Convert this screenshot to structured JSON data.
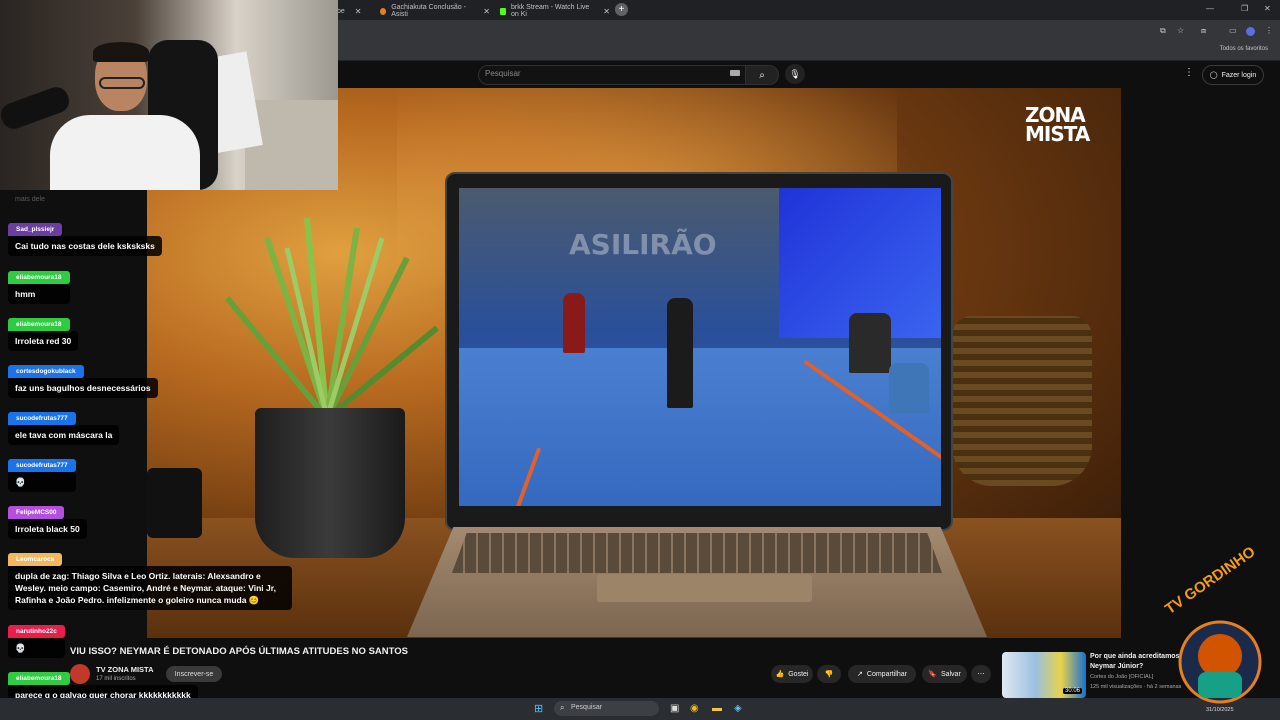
{
  "browser": {
    "tabs": [
      {
        "title": "be",
        "favicon_color": "#c0392b"
      },
      {
        "title": "Gachiakuta Conclusão - Asisti",
        "favicon_color": "#e67e22"
      },
      {
        "title": "brkk Stream - Watch Live on Ki",
        "favicon_color": "#53fc18"
      }
    ],
    "bookmarks_all": "Todos os favoritos"
  },
  "youtube": {
    "search_placeholder": "Pesquisar",
    "login_label": "Fazer login",
    "video_title": "VIU ISSO? NEYMAR É DETONADO APÓS ÚLTIMAS ATITUDES NO SANTOS",
    "channel_name": "TV ZONA MISTA",
    "channel_subs": "17 mil inscritos",
    "subscribe_label": "Inscrever-se",
    "like_label": "Gostei",
    "share_label": "Compartilhar",
    "save_label": "Salvar",
    "logo_line1": "ZONA",
    "logo_line2": "MISTA",
    "studio_text": "ASILIRÃO",
    "recommended": {
      "title": "Por que ainda acreditamos em Neymar Júnior?",
      "channel": "Cortes do João [OFICIAL]",
      "stats": "125 mil visualizações · há 2 semanas",
      "duration": "30:06"
    }
  },
  "chat": {
    "faded_name": "mais dele",
    "messages": [
      {
        "user": "Sad_plssiejr",
        "color": "#6b3fa0",
        "text": "Cai tudo nas costas dele ksksksks"
      },
      {
        "user": "eliabemoura18",
        "color": "#2ecc40",
        "text": "hmm"
      },
      {
        "user": "eliabemoura18",
        "color": "#2ecc40",
        "text": "Irroleta red 30"
      },
      {
        "user": "cortesdogokublack",
        "color": "#1a73e8",
        "text": "faz uns bagulhos desnecessários"
      },
      {
        "user": "sucodefrutas777",
        "color": "#1a73e8",
        "text": "ele tava com máscara la"
      },
      {
        "user": "sucodefrutas777",
        "color": "#1a73e8",
        "text": "💀"
      },
      {
        "user": "FelipeMCS00",
        "color": "#b44fe0",
        "text": "Irroleta black 50"
      },
      {
        "user": "Leomcarocs",
        "color": "#f0b960",
        "text": "dupla de zag: Thiago Silva e Leo Ortiz. laterais: Alexsandro e Wesley. meio campo: Casemiro, André e Neymar. ataque: Vini Jr, Rafinha e João Pedro. infelizmente o goleiro nunca muda 😊"
      },
      {
        "user": "narutinho22c",
        "color": "#e91e4f",
        "text": "💀"
      },
      {
        "user": "eliabemoura18",
        "color": "#2ecc40",
        "text": "parece q o galvao quer chorar kkkkkkkkkkk"
      }
    ]
  },
  "taskbar": {
    "search_label": "Pesquisar",
    "clock": "31/10/2025"
  },
  "overlay": {
    "brand": "TV GORDINHO"
  }
}
